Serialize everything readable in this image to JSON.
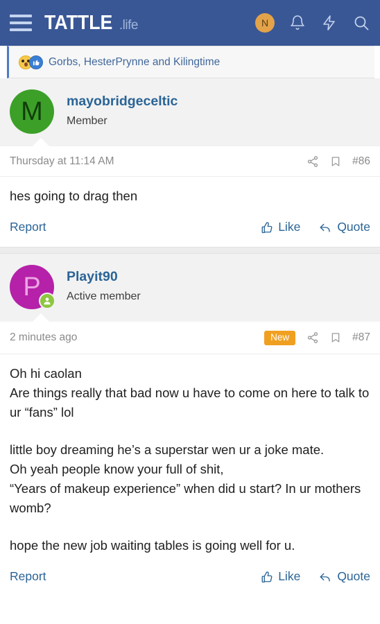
{
  "navbar": {
    "menu_icon": "hamburger-menu-icon",
    "brand_main": "TATTLE",
    "brand_sub": ".life",
    "avatar_initial": "N",
    "avatar_color": "#e3a34a",
    "bell_icon": "bell-icon",
    "bolt_icon": "lightning-bolt-icon",
    "search_icon": "search-icon",
    "background": "#3a5795"
  },
  "reaction_strip": {
    "emoji_1": "shocked-face-emoji",
    "emoji_2": "thumbs-up-emoji",
    "names": "Gorbs, HesterPrynne and Kilingtime"
  },
  "posts": [
    {
      "avatar_initial": "M",
      "avatar_color": "#3ca028",
      "avatar_text_color": "#113d0a",
      "online": false,
      "username": "mayobridgeceltic",
      "user_title": "Member",
      "timestamp": "Thursday at 11:14 AM",
      "new_badge": "",
      "share_icon": "share-icon",
      "bookmark_icon": "bookmark-icon",
      "post_number": "#86",
      "paragraphs": [
        "hes going to drag then"
      ],
      "report_label": "Report",
      "like_label": "Like",
      "quote_label": "Quote"
    },
    {
      "avatar_initial": "P",
      "avatar_color": "#b521a8",
      "avatar_text_color": "#eda4e3",
      "online": true,
      "username": "Playit90",
      "user_title": "Active member",
      "timestamp": "2 minutes ago",
      "new_badge": "New",
      "share_icon": "share-icon",
      "bookmark_icon": "bookmark-icon",
      "post_number": "#87",
      "paragraphs": [
        "Oh hi caolan",
        "Are things really that bad now u have to come on here to talk to ur “fans” lol",
        "",
        "little boy dreaming he’s a superstar wen ur a joke mate.",
        "Oh yeah people know your full of shit,",
        "“Years of makeup experience” when did u start? In ur mothers womb?",
        "",
        "hope the new job waiting tables is going well for u."
      ],
      "report_label": "Report",
      "like_label": "Like",
      "quote_label": "Quote"
    }
  ],
  "colors": {
    "brand_blue": "#3a5795",
    "link_blue": "#2a6496",
    "new_badge_orange": "#f0a020",
    "online_green": "#8dc63f"
  }
}
